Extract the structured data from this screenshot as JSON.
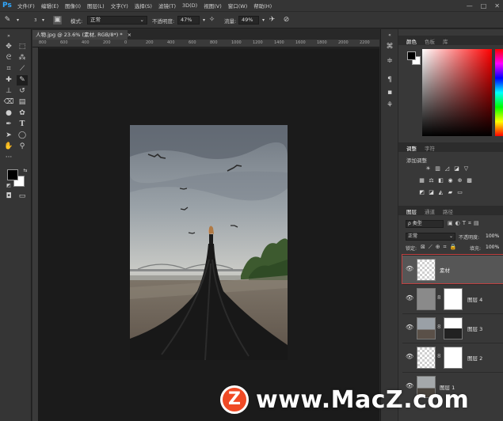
{
  "app": {
    "logo": "Ps"
  },
  "menu": [
    "文件(F)",
    "编辑(E)",
    "图像(I)",
    "图层(L)",
    "文字(Y)",
    "选择(S)",
    "滤镜(T)",
    "3D(D)",
    "视图(V)",
    "窗口(W)",
    "帮助(H)"
  ],
  "window_controls": {
    "minimize": "—",
    "maximize": "□",
    "close": "✕"
  },
  "options_bar": {
    "brush_size": "3",
    "mode_label": "模式:",
    "mode_value": "正常",
    "opacity_label": "不透明度:",
    "opacity_value": "47%",
    "flow_label": "流量:",
    "flow_value": "49%"
  },
  "document_tab": {
    "title": "人物.jpg @ 23.6% (素材, RGB/8*) *",
    "close": "×"
  },
  "ruler_top_ticks": [
    "800",
    "600",
    "400",
    "200",
    "0",
    "200",
    "400",
    "600",
    "800",
    "1000",
    "1200",
    "1400",
    "1600",
    "1800",
    "2000",
    "2200"
  ],
  "panels": {
    "color_tabs": [
      "颜色",
      "色板",
      "库"
    ],
    "adjust_tabs": [
      "调整",
      "字符"
    ],
    "adjust_title": "添加调整",
    "layers_tabs": [
      "图层",
      "通道",
      "路径"
    ],
    "filter_kind": "ρ 类型",
    "blend_mode": "正常",
    "opacity_label": "不透明度:",
    "opacity_value": "100%",
    "lock_label": "锁定:",
    "fill_label": "填充:",
    "fill_value": "100%",
    "layers": [
      {
        "name": "素材",
        "selected": true
      },
      {
        "name": "图层 4",
        "selected": false
      },
      {
        "name": "图层 3",
        "selected": false
      },
      {
        "name": "图层 2",
        "selected": false
      },
      {
        "name": "图层 1",
        "selected": false
      }
    ]
  },
  "watermark": {
    "logo": "Z",
    "text": "www.MacZ.com"
  },
  "colors": {
    "accent": "#31a8ff",
    "watermark_logo": "#f04a25"
  }
}
